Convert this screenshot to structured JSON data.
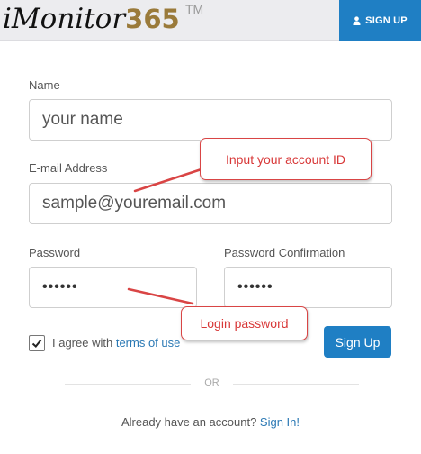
{
  "header": {
    "logo_part1": "iMonitor",
    "logo_part2": "365",
    "trademark": "TM",
    "signup_label": "SIGN UP",
    "signup_icon": "user-icon"
  },
  "form": {
    "name_label": "Name",
    "name_value": "your name",
    "email_label": "E-mail Address",
    "email_value": "sample@youremail.com",
    "password_label": "Password",
    "password_value": "••••••",
    "password_confirm_label": "Password Confirmation",
    "password_confirm_value": "••••••",
    "agree_text": "I agree with",
    "terms_link": "terms of use",
    "agree_checked": true,
    "submit_label": "Sign Up",
    "or_text": "OR",
    "already_text": "Already have an account?",
    "signin_link": "Sign In!"
  },
  "annotations": {
    "account_id": "Input your account ID",
    "login_password": "Login password",
    "color": "#d94545"
  },
  "colors": {
    "accent": "#1f7fc4",
    "link": "#2a78b4",
    "logo_gold": "#9a7a3a"
  }
}
